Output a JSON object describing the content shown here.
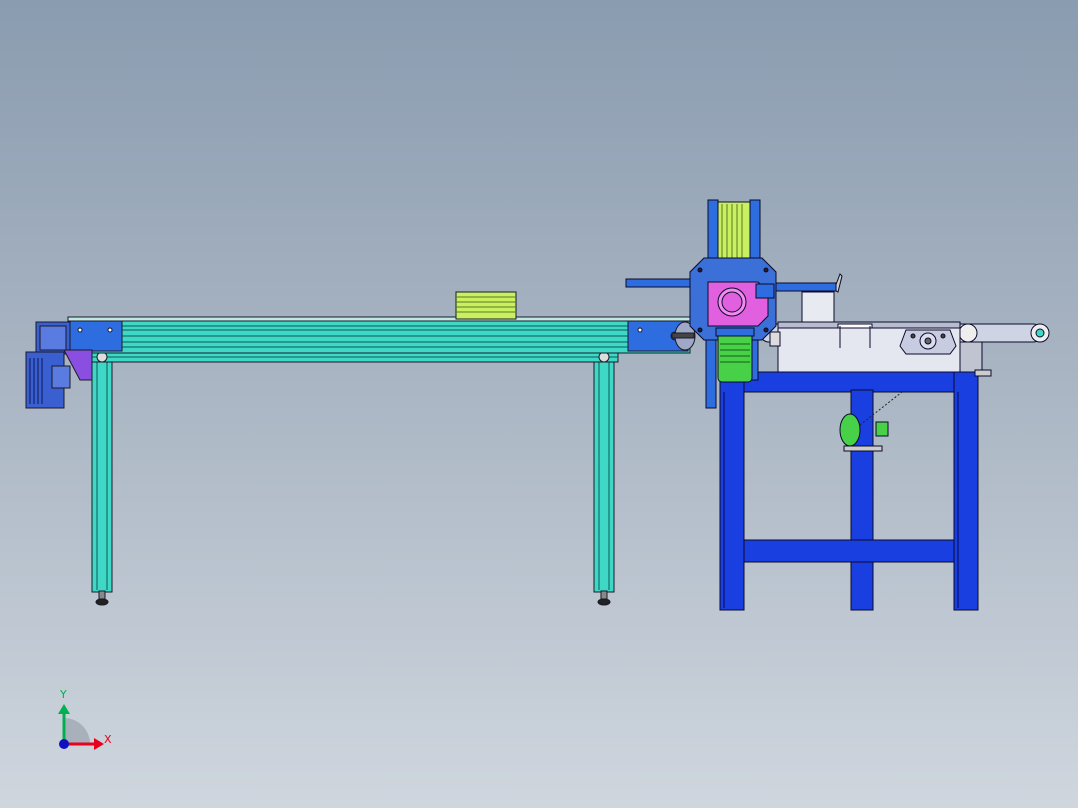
{
  "triad": {
    "x_label": "X",
    "y_label": "Y",
    "x_color": "#e8001c",
    "y_color": "#00b050",
    "z_color": "#1010c0"
  },
  "colors": {
    "background_top": "#8a9cb0",
    "background_bottom": "#cfd6de",
    "profile": "#3fd8c6",
    "frame_blue": "#1a3fe0",
    "motor_blue": "#3a5fd0",
    "bracket_blue": "#2e6de0",
    "magenta": "#e060e0",
    "green_part": "#48d048",
    "stack_yellow": "#c8f060",
    "housing_gray": "#e4e6f0"
  },
  "parts": [
    "drive-motor",
    "conveyor-frame",
    "conveyor-legs",
    "product-stack",
    "rotary-transfer",
    "magenta-hub",
    "green-motor",
    "right-table",
    "belt-conveyor",
    "bearing-housing",
    "chain-drive"
  ]
}
